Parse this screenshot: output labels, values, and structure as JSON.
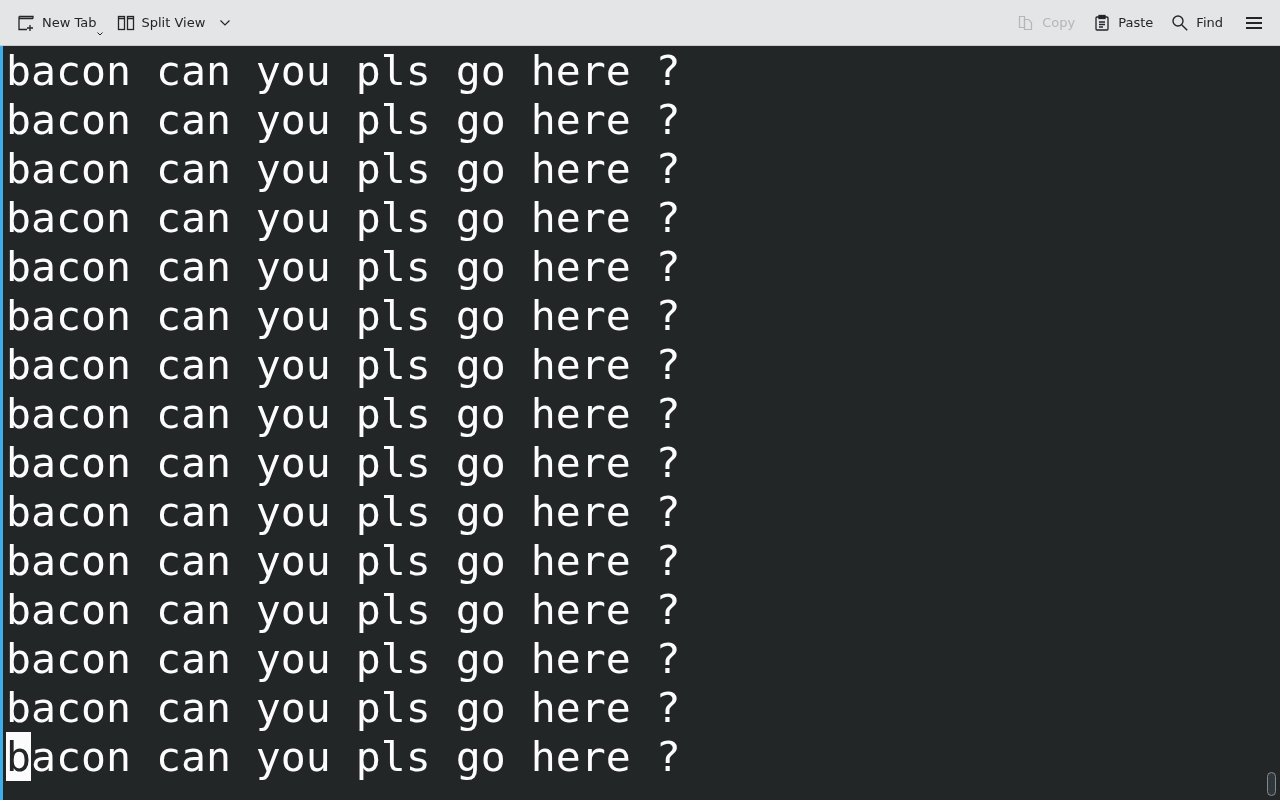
{
  "toolbar": {
    "left": [
      {
        "kind": "newtab",
        "label": "New Tab",
        "disabled": false,
        "caret": true,
        "chevron": false
      },
      {
        "kind": "split",
        "label": "Split View",
        "disabled": false,
        "caret": false,
        "chevron": true
      }
    ],
    "right": [
      {
        "kind": "copy",
        "label": "Copy",
        "disabled": true
      },
      {
        "kind": "paste",
        "label": "Paste",
        "disabled": false
      },
      {
        "kind": "find",
        "label": "Find",
        "disabled": false
      }
    ]
  },
  "terminal": {
    "lines": [
      {
        "text": "bacon can you pls go here ?",
        "cursor": false
      },
      {
        "text": "bacon can you pls go here ?",
        "cursor": false
      },
      {
        "text": "bacon can you pls go here ?",
        "cursor": false
      },
      {
        "text": "bacon can you pls go here ?",
        "cursor": false
      },
      {
        "text": "bacon can you pls go here ?",
        "cursor": false
      },
      {
        "text": "bacon can you pls go here ?",
        "cursor": false
      },
      {
        "text": "bacon can you pls go here ?",
        "cursor": false
      },
      {
        "text": "bacon can you pls go here ?",
        "cursor": false
      },
      {
        "text": "bacon can you pls go here ?",
        "cursor": false
      },
      {
        "text": "bacon can you pls go here ?",
        "cursor": false
      },
      {
        "text": "bacon can you pls go here ?",
        "cursor": false
      },
      {
        "text": "bacon can you pls go here ?",
        "cursor": false
      },
      {
        "text": "bacon can you pls go here ?",
        "cursor": false
      },
      {
        "text": "bacon can you pls go here ?",
        "cursor": false
      },
      {
        "text": "bacon can you pls go here ?",
        "cursor": true
      }
    ]
  }
}
